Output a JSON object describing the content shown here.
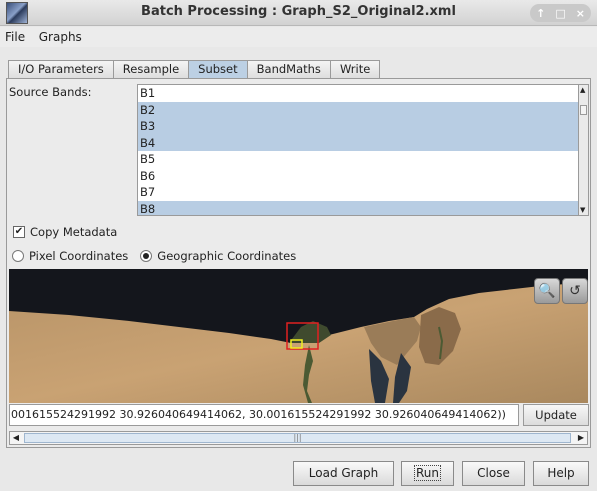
{
  "window": {
    "title": "Batch Processing : Graph_S2_Original2.xml",
    "controls": [
      "↑",
      "□",
      "×"
    ]
  },
  "menu": [
    "File",
    "Graphs"
  ],
  "tabs": [
    {
      "label": "I/O Parameters",
      "active": false
    },
    {
      "label": "Resample",
      "active": false
    },
    {
      "label": "Subset",
      "active": true
    },
    {
      "label": "BandMaths",
      "active": false
    },
    {
      "label": "Write",
      "active": false
    }
  ],
  "subset": {
    "source_bands_label": "Source Bands:",
    "bands": [
      {
        "name": "B1",
        "selected": false
      },
      {
        "name": "B2",
        "selected": true
      },
      {
        "name": "B3",
        "selected": true
      },
      {
        "name": "B4",
        "selected": true
      },
      {
        "name": "B5",
        "selected": false
      },
      {
        "name": "B6",
        "selected": false
      },
      {
        "name": "B7",
        "selected": false
      },
      {
        "name": "B8",
        "selected": true
      }
    ],
    "copy_metadata_label": "Copy Metadata",
    "copy_metadata_checked": true,
    "pixel_coords_label": "Pixel Coordinates",
    "geo_coords_label": "Geographic Coordinates",
    "selected_coord_mode": "geographic",
    "wkt_value": "001615524291992 30.926040649414062, 30.001615524291992 30.926040649414062))",
    "update_label": "Update"
  },
  "colors": {
    "selection": "#b8cde3",
    "active_tab": "#bcd0e4",
    "subset_box": "#e02020",
    "aoi_box": "#f0f020"
  },
  "buttons": {
    "load_graph": "Load Graph",
    "run": "Run",
    "close": "Close",
    "help": "Help"
  }
}
